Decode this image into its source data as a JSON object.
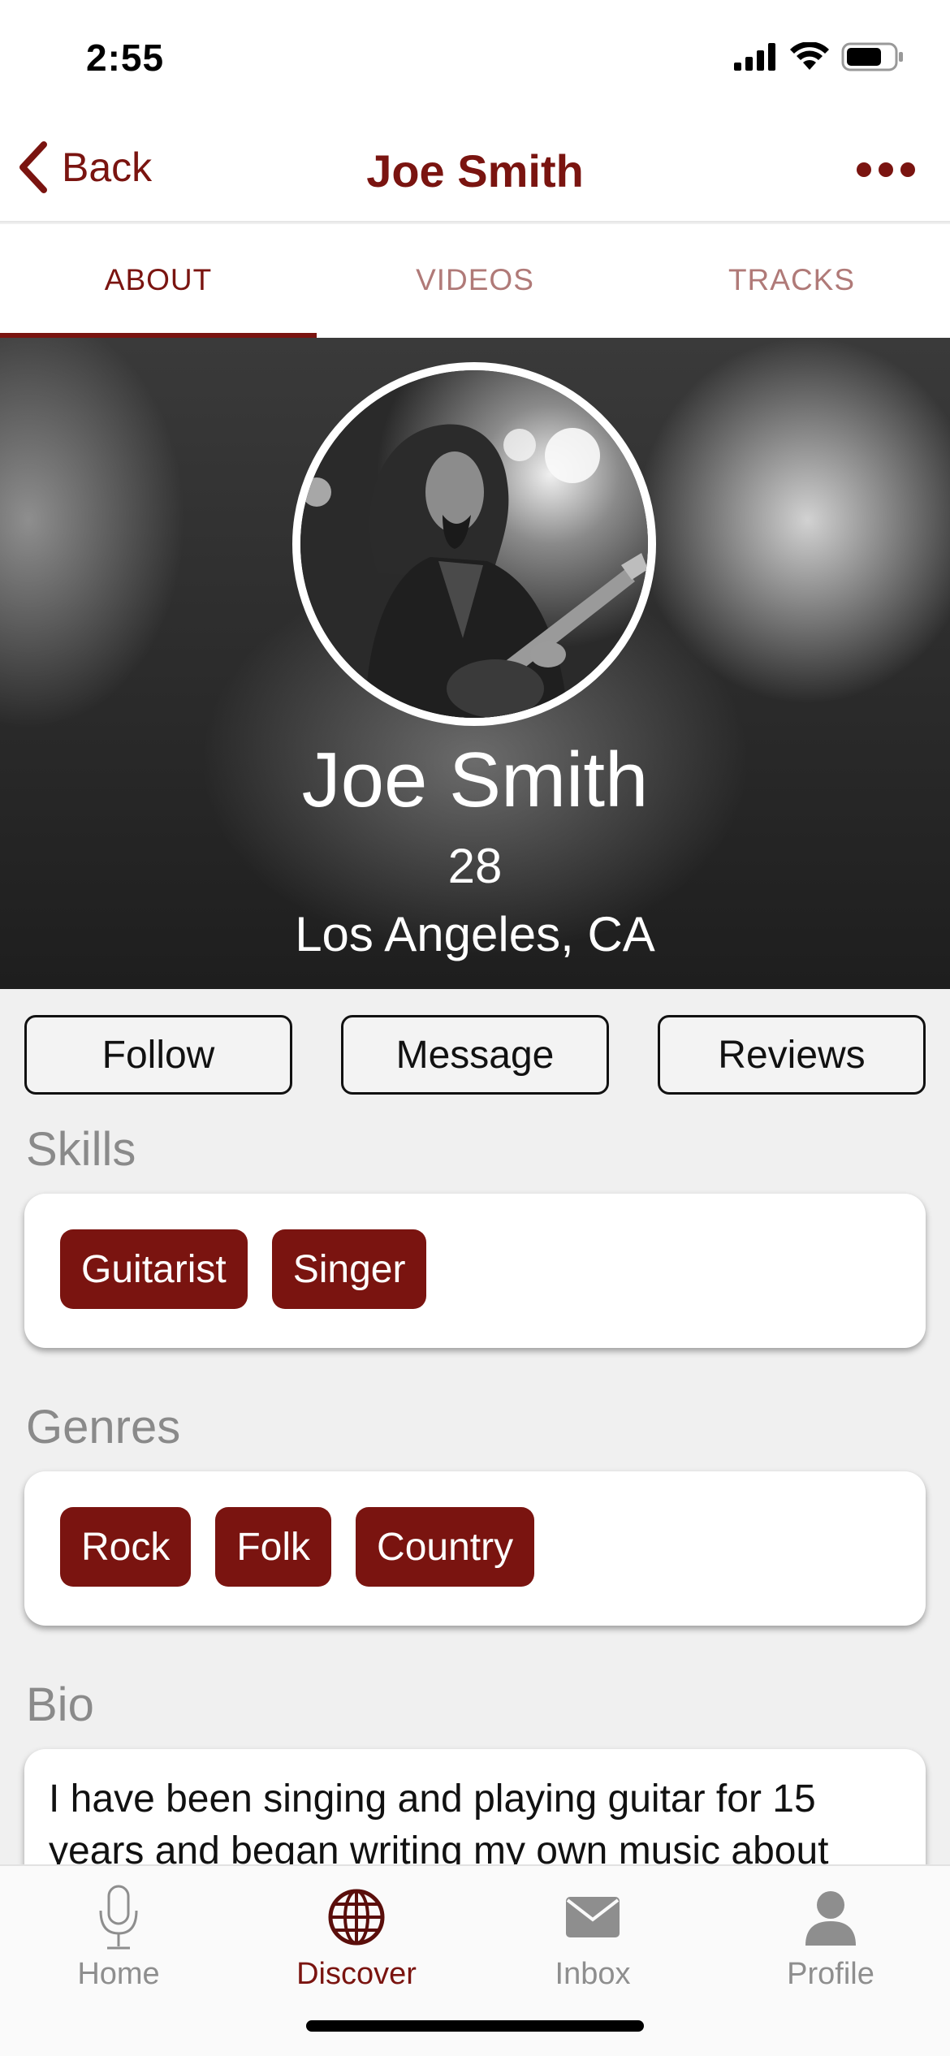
{
  "status_bar": {
    "time": "2:55"
  },
  "nav": {
    "back_label": "Back",
    "title": "Joe Smith"
  },
  "tabs": [
    {
      "label": "ABOUT",
      "active": true
    },
    {
      "label": "VIDEOS",
      "active": false
    },
    {
      "label": "TRACKS",
      "active": false
    }
  ],
  "profile": {
    "name": "Joe Smith",
    "age": "28",
    "location": "Los Angeles, CA"
  },
  "actions": {
    "follow": "Follow",
    "message": "Message",
    "reviews": "Reviews"
  },
  "skills": {
    "title": "Skills",
    "items": [
      "Guitarist",
      "Singer"
    ]
  },
  "genres": {
    "title": "Genres",
    "items": [
      "Rock",
      "Folk",
      "Country"
    ]
  },
  "bio": {
    "title": "Bio",
    "text": "I have been singing and playing guitar for 15 years and began writing my own music about"
  },
  "tabbar": [
    {
      "label": "Home",
      "icon": "microphone-icon",
      "active": false
    },
    {
      "label": "Discover",
      "icon": "globe-icon",
      "active": true
    },
    {
      "label": "Inbox",
      "icon": "envelope-icon",
      "active": false
    },
    {
      "label": "Profile",
      "icon": "person-icon",
      "active": false
    }
  ],
  "colors": {
    "accent": "#7a1410",
    "background": "#f0f0f0",
    "inactive": "#8e8e8e"
  }
}
